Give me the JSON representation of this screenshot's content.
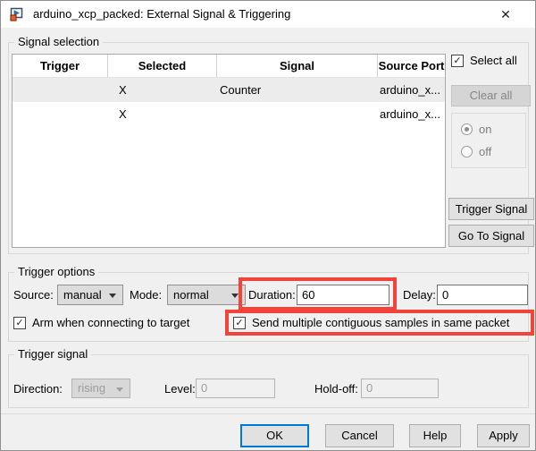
{
  "window": {
    "title": "arduino_xcp_packed: External Signal & Triggering"
  },
  "icons": {
    "close": "✕",
    "checkmark": "✓"
  },
  "colors": {
    "highlight_red": "#f4433a",
    "focus_blue": "#0078d7",
    "selected_row_bg": "#ececec"
  },
  "signal_selection": {
    "label": "Signal selection",
    "table": {
      "columns": [
        "Trigger",
        "Selected",
        "Signal",
        "Source Port"
      ],
      "rows": [
        {
          "trigger": "",
          "selected": "X",
          "signal": "Counter",
          "source_port": "arduino_x...",
          "highlighted": true
        },
        {
          "trigger": "",
          "selected": "X",
          "signal": "",
          "source_port": "arduino_x...",
          "highlighted": false
        }
      ]
    },
    "select_all_label": "Select all",
    "select_all_checked": true,
    "clear_all_label": "Clear all",
    "radio_on_label": "on",
    "radio_off_label": "off",
    "trigger_signal_button": "Trigger Signal",
    "go_to_signal_button": "Go To Signal"
  },
  "trigger_options": {
    "label": "Trigger options",
    "source_label": "Source:",
    "source_value": "manual",
    "mode_label": "Mode:",
    "mode_value": "normal",
    "duration_label": "Duration:",
    "duration_value": "60",
    "delay_label": "Delay:",
    "delay_value": "0",
    "arm_checkbox_label": "Arm when connecting to target",
    "arm_checked": true,
    "send_checkbox_label": "Send multiple contiguous samples in same packet",
    "send_checked": true
  },
  "trigger_signal": {
    "label": "Trigger signal",
    "direction_label": "Direction:",
    "direction_value": "rising",
    "level_label": "Level:",
    "level_value": "0",
    "holdoff_label": "Hold-off:",
    "holdoff_value": "0"
  },
  "footer": {
    "ok": "OK",
    "cancel": "Cancel",
    "help": "Help",
    "apply": "Apply"
  }
}
